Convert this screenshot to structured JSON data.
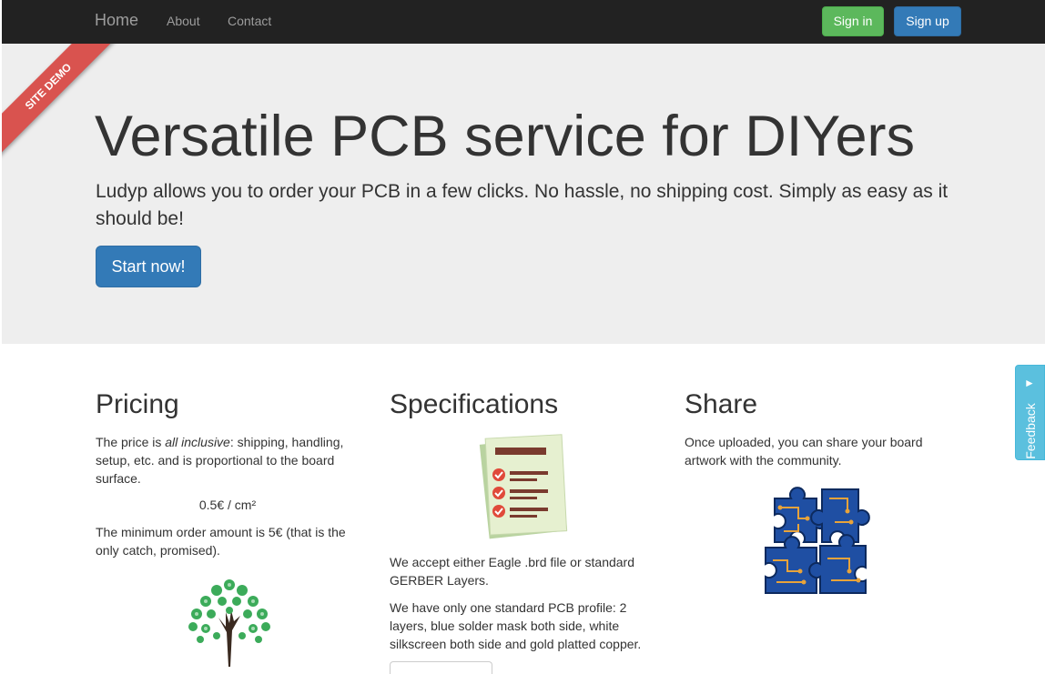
{
  "navbar": {
    "brand": "Home",
    "links": [
      "About",
      "Contact"
    ],
    "signin_label": "Sign in",
    "signup_label": "Sign up"
  },
  "ribbon": {
    "label": "SITE DEMO"
  },
  "hero": {
    "title": "Versatile PCB service for DIYers",
    "text": "Ludyp allows you to order your PCB in a few clicks. No hassle, no shipping cost. Simply as easy as it should be!",
    "button_label": "Start now!"
  },
  "pricing": {
    "heading": "Pricing",
    "text_before": "The price is ",
    "text_emphasis": "all inclusive",
    "text_after": ": shipping, handling, setup, etc. and is proportional to the board surface.",
    "price": "0.5€ / cm²",
    "minimum": "The minimum order amount is 5€ (that is the only catch, promised).",
    "icon": "tree-icon"
  },
  "specifications": {
    "heading": "Specifications",
    "icon": "checklist-icon",
    "para1": "We accept either Eagle .brd file or standard GERBER Layers.",
    "para2": "We have only one standard PCB profile: 2 layers, blue solder mask both side, white silkscreen both side and gold platted copper."
  },
  "share": {
    "heading": "Share",
    "text": "Once uploaded, you can share your board artwork with the community.",
    "icon": "puzzle-pcb-icon"
  },
  "feedback": {
    "label": "Feedback",
    "icon": "megaphone-icon"
  },
  "colors": {
    "navbar": "#222222",
    "success": "#5cb85c",
    "primary": "#337ab7",
    "ribbon": "#d9534f",
    "feedback": "#5bc0de"
  }
}
